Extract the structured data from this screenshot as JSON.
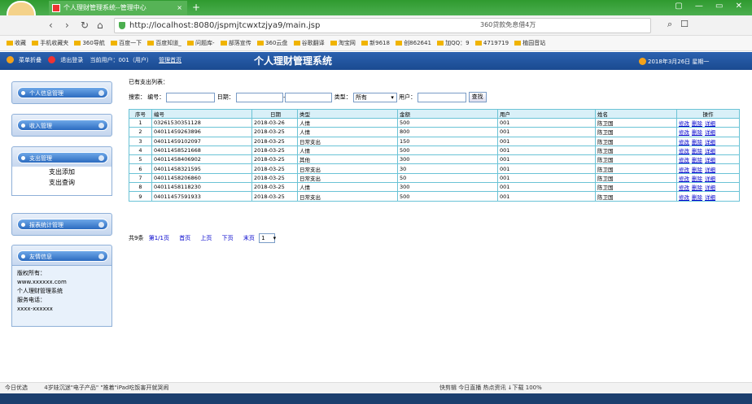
{
  "browser": {
    "tab_title": "个人理财管理系统--管理中心",
    "tab_close": "×",
    "new_tab": "+",
    "window_controls": "▢ — ▭ ✕",
    "url": "http://localhost:8080/jspmjtcwxtzjya9/main.jsp",
    "url_host": "localhost",
    "url_ad": "360贷款免息借4万",
    "bookmarks": [
      "收藏",
      "手机收藏夹",
      "360导航",
      "百度一下",
      "百度知道_",
      "问题库-",
      "部落宣传",
      "360云盘",
      "谷歌翻译",
      "淘宝网",
      "新9618",
      "创862641",
      "加QQ：9",
      "4719719",
      "植园音站"
    ]
  },
  "header": {
    "collapse_label": "菜单折叠",
    "logout_label": "退出登录",
    "current_user_label": "当前用户：001（用户）",
    "home_label": "管理首页",
    "title": "个人理财管理系统",
    "date": "2018年3月26日 星期一"
  },
  "sidebar": {
    "menus": [
      "个人信息管理",
      "收入管理",
      "支出管理",
      "报表统计管理",
      "友情信息"
    ],
    "submenu": [
      "支出添加",
      "支出查询"
    ],
    "info_lines": [
      "版权所有：",
      "www.xxxxxx.com",
      "个人理财管理系统",
      "服务电话：",
      "xxxx-xxxxxx"
    ]
  },
  "main": {
    "list_title": "已有支出列表：",
    "search": {
      "label": "搜索：",
      "num_label": "编号：",
      "date_label": "日期：",
      "dash": "-",
      "type_label": "类型：",
      "type_value": "所有",
      "user_label": "用户：",
      "button": "查找"
    },
    "columns": [
      "序号",
      "编号",
      "日期",
      "类型",
      "金额",
      "用户",
      "姓名",
      "操作"
    ],
    "rows": [
      [
        "1",
        "03261530351128",
        "2018-03-26",
        "人情",
        "500",
        "001",
        "陈卫国"
      ],
      [
        "2",
        "04011459263896",
        "2018-03-25",
        "人情",
        "800",
        "001",
        "陈卫国"
      ],
      [
        "3",
        "04011459102097",
        "2018-03-25",
        "日常支出",
        "150",
        "001",
        "陈卫国"
      ],
      [
        "4",
        "04011458521668",
        "2018-03-25",
        "人情",
        "500",
        "001",
        "陈卫国"
      ],
      [
        "5",
        "04011458406902",
        "2018-03-25",
        "其他",
        "300",
        "001",
        "陈卫国"
      ],
      [
        "6",
        "04011458321595",
        "2018-03-25",
        "日常支出",
        "30",
        "001",
        "陈卫国"
      ],
      [
        "7",
        "04011458206860",
        "2018-03-25",
        "日常支出",
        "50",
        "001",
        "陈卫国"
      ],
      [
        "8",
        "04011458118230",
        "2018-03-25",
        "人情",
        "300",
        "001",
        "陈卫国"
      ],
      [
        "9",
        "04011457591933",
        "2018-03-25",
        "日常支出",
        "500",
        "001",
        "陈卫国"
      ]
    ],
    "ops": [
      "修改",
      "删除",
      "详细"
    ],
    "pager": {
      "total": "共9条",
      "page": "第1/1页",
      "first": "首页",
      "prev": "上页",
      "next": "下页",
      "last": "末页",
      "select": "1"
    }
  },
  "statusbar": {
    "left": "今日优选",
    "news": "4岁娃沉迷\"电子产品\" \"推着\"iPad吃饭害开就哭闹",
    "right": "快剪辑  今日直播  热点资讯  ↓下载  100%"
  }
}
